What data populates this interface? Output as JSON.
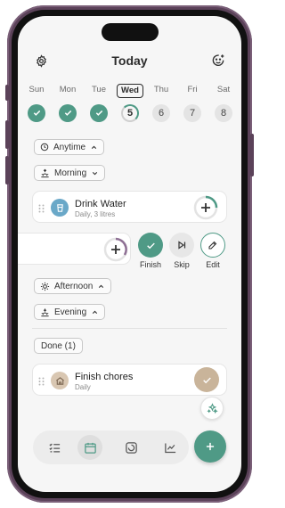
{
  "header": {
    "title": "Today"
  },
  "weekdays": [
    "Sun",
    "Mon",
    "Tue",
    "Wed",
    "Thu",
    "Fri",
    "Sat"
  ],
  "dates": {
    "today": "5",
    "future": [
      "6",
      "7",
      "8"
    ]
  },
  "sections": {
    "anytime": "Anytime",
    "morning": "Morning",
    "afternoon": "Afternoon",
    "evening": "Evening",
    "done": "Done (1)"
  },
  "habits": {
    "drink_water": {
      "title": "Drink Water",
      "subtitle": "Daily, 3 litres"
    },
    "finish_chores": {
      "title": "Finish chores",
      "subtitle": "Daily"
    }
  },
  "swipe_actions": {
    "finish": "Finish",
    "skip": "Skip",
    "edit": "Edit"
  },
  "colors": {
    "accent": "#4f9a86",
    "done_check": "#c9b49a",
    "water_icon_bg": "#6aa8c8",
    "chores_icon_bg": "#d9c7b2"
  }
}
